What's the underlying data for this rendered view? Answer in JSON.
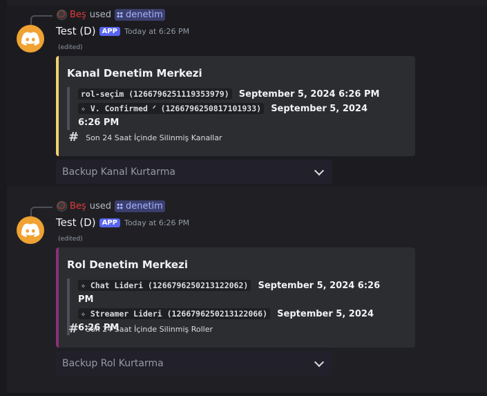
{
  "messages": [
    {
      "reference": {
        "user": "Beş",
        "used_text": "used",
        "command": "denetim"
      },
      "author": "Test (D)",
      "badge": "APP",
      "timestamp": "Today at 6:26 PM",
      "edited": "(edited)",
      "embed": {
        "accent_color": "#f0d070",
        "title": "Kanal Denetim Merkezi",
        "entries": [
          {
            "code": "rol-seçim (1266796251119353979)",
            "date": "September 5, 2024 6:26 PM"
          },
          {
            "code": "✧ V. Confirmed ᐟ (1266796250817101933)",
            "date": "September 5, 2024 6:26 PM"
          }
        ],
        "footer": "Son 24 Saat İçinde Silinmiş Kanallar"
      },
      "select": {
        "placeholder": "Backup Kanal Kurtarma"
      }
    },
    {
      "reference": {
        "user": "Beş",
        "used_text": "used",
        "command": "denetim"
      },
      "author": "Test (D)",
      "badge": "APP",
      "timestamp": "Today at 6:26 PM",
      "edited": "(edited)",
      "embed": {
        "accent_color": "#8c2f7a",
        "title": "Rol Denetim Merkezi",
        "entries": [
          {
            "code": "✧ Chat Lideri (1266796250213122062)",
            "date": "September 5, 2024 6:26 PM"
          },
          {
            "code": "✧ Streamer Lideri (1266796250213122066)",
            "date": "September 5, 2024 6:26 PM"
          }
        ],
        "footer": "Son 24 Saat İçinde Silinmiş Roller"
      },
      "select": {
        "placeholder": "Backup Rol Kurtarma"
      }
    }
  ],
  "icons": {
    "avatar": "discord-logo-icon",
    "footer": "hash-icon",
    "command": "command-icon",
    "select": "chevron-down-icon"
  },
  "colors": {
    "brand_avatar": "#f0a232",
    "app_badge": "#5865f2",
    "reference_user": "#e33b3b",
    "command_chip": "#a7b3ff"
  }
}
